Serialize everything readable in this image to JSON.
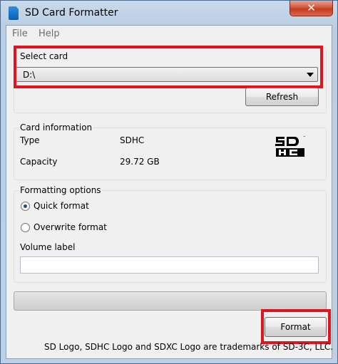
{
  "window": {
    "title": "SD Card Formatter",
    "close_label": "✕"
  },
  "menu": {
    "file": "File",
    "help": "Help"
  },
  "select_card": {
    "legend": "Select card",
    "selected": "D:\\",
    "refresh_label": "Refresh"
  },
  "card_info": {
    "legend": "Card information",
    "type_label": "Type",
    "type_value": "SDHC",
    "capacity_label": "Capacity",
    "capacity_value": "29.72 GB",
    "logo_icon": "sdhc-logo-icon"
  },
  "formatting": {
    "legend": "Formatting options",
    "quick_format": "Quick format",
    "quick_format_checked": true,
    "overwrite_format": "Overwrite format",
    "overwrite_format_checked": false,
    "volume_label": "Volume label",
    "volume_value": ""
  },
  "progress": {
    "value": 0
  },
  "actions": {
    "format_label": "Format"
  },
  "footer": {
    "text": "SD Logo, SDHC Logo and SDXC Logo are trademarks of SD-3C, LLC."
  },
  "highlight_color": "#e1131f"
}
